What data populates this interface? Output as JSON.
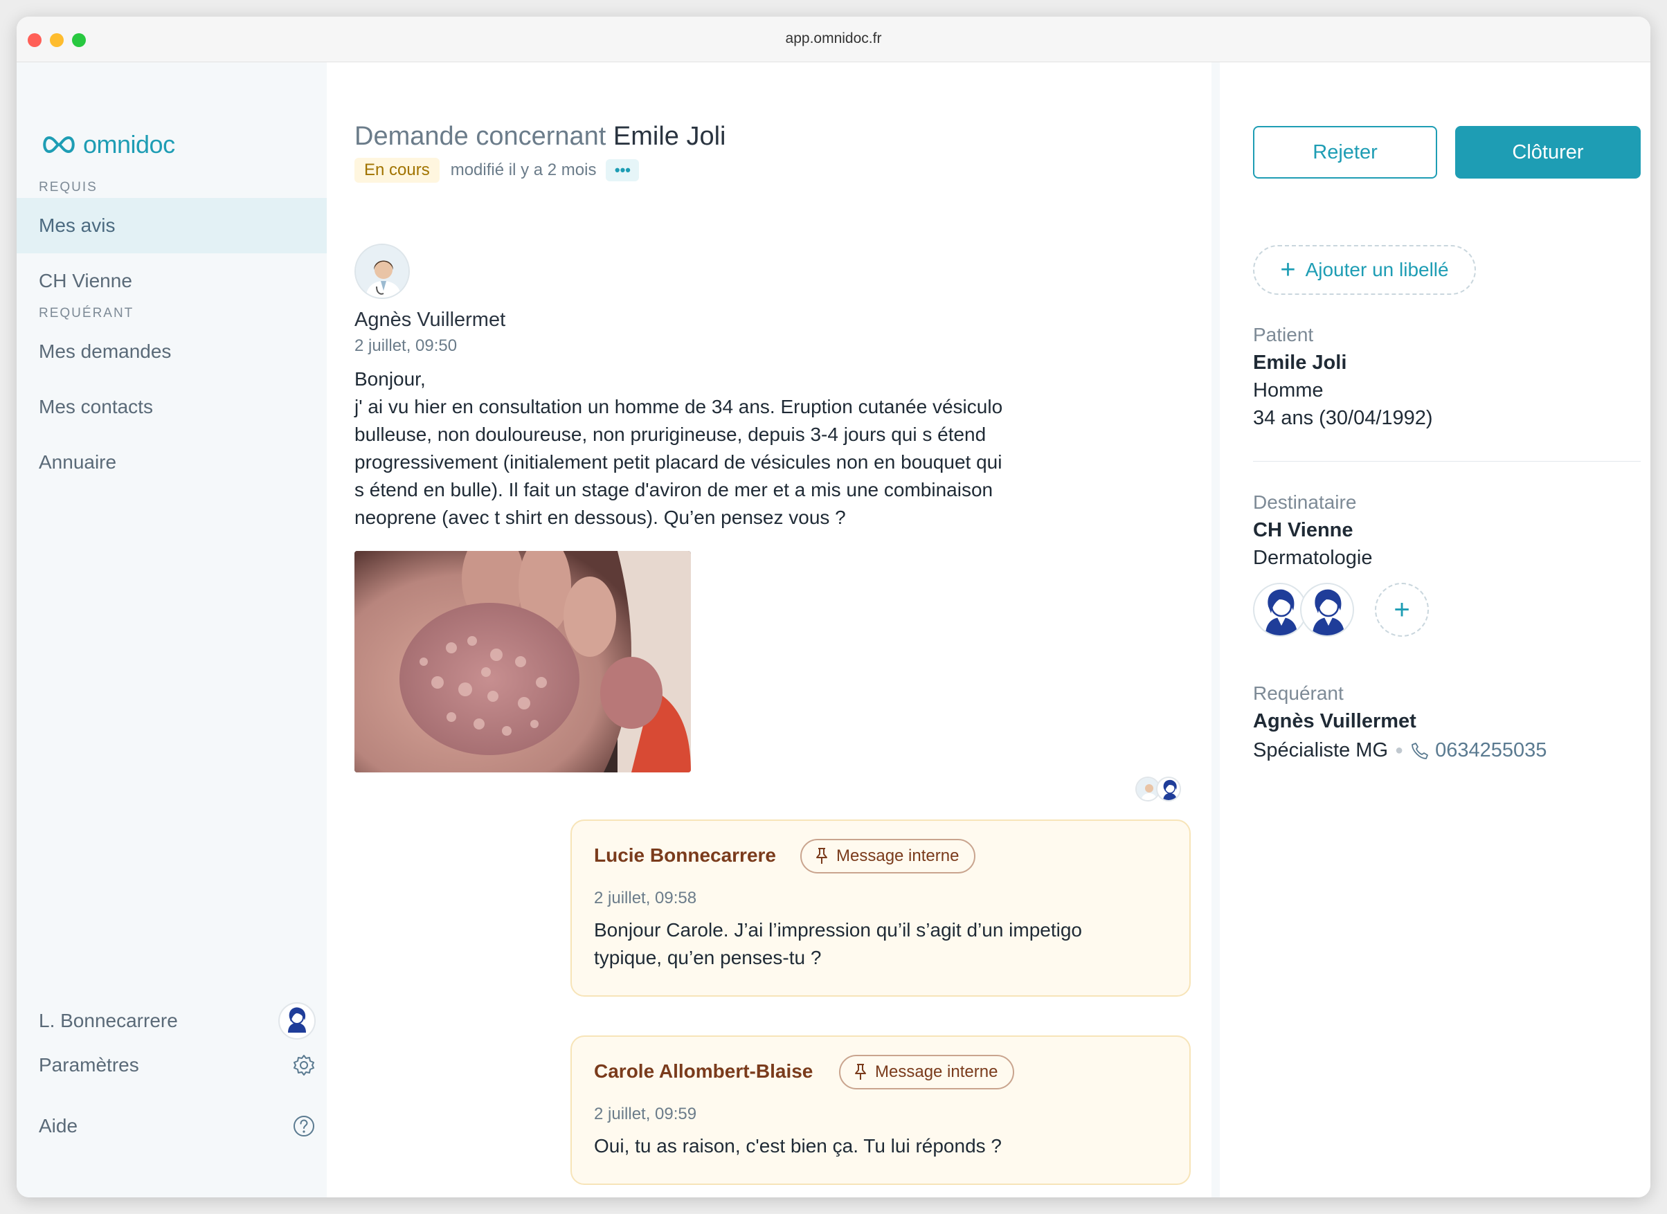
{
  "browser": {
    "url": "app.omnidoc.fr"
  },
  "brand": {
    "name": "omnidoc",
    "color": "#1e9db4"
  },
  "sidebar": {
    "section_requis": "REQUIS",
    "requis_items": [
      {
        "label": "Mes avis",
        "active": true
      },
      {
        "label": "CH Vienne",
        "active": false
      }
    ],
    "section_requerant": "REQUÉRANT",
    "requerant_items": [
      {
        "label": "Mes demandes"
      },
      {
        "label": "Mes contacts"
      },
      {
        "label": "Annuaire"
      }
    ],
    "user_name": "L. Bonnecarrere",
    "settings_label": "Paramètres",
    "help_label": "Aide"
  },
  "request": {
    "title_prefix": "Demande concernant",
    "patient_name": "Emile Joli",
    "status": "En cours",
    "modified": "modifié il y a 2 mois",
    "more_label": "•••"
  },
  "first_message": {
    "author": "Agnès Vuillermet",
    "date": "2 juillet, 09:50",
    "greeting": "Bonjour,",
    "lines": [
      "j' ai vu hier en consultation un homme de 34 ans. Eruption cutanée vésiculo",
      "bulleuse, non douloureuse, non prurigineuse, depuis 3-4 jours qui s étend",
      "progressivement (initialement petit placard de vésicules non en bouquet qui",
      "s étend en bulle). Il fait un stage d'aviron de mer et a mis  une combinaison",
      "neoprene (avec t shirt en dessous). Qu’en pensez vous ?"
    ]
  },
  "internal_messages": [
    {
      "author": "Lucie Bonnecarrere",
      "tag": "Message interne",
      "date": "2 juillet, 09:58",
      "lines": [
        "Bonjour Carole. J’ai l’impression qu’il s’agit d’un impetigo",
        "typique, qu’en penses-tu ?"
      ]
    },
    {
      "author": "Carole Allombert-Blaise",
      "tag": "Message interne",
      "date": "2 juillet, 09:59",
      "lines": [
        "Oui, tu as raison, c'est bien ça. Tu lui réponds ?"
      ]
    }
  ],
  "actions": {
    "reject": "Rejeter",
    "close": "Clôturer",
    "add_label": "Ajouter un libellé"
  },
  "patient": {
    "label": "Patient",
    "name": "Emile Joli",
    "sex": "Homme",
    "age": "34 ans (30/04/1992)"
  },
  "recipient": {
    "label": "Destinataire",
    "name": "CH Vienne",
    "department": "Dermatologie"
  },
  "requester": {
    "label": "Requérant",
    "name": "Agnès Vuillermet",
    "role": "Spécialiste MG",
    "phone": "0634255035"
  }
}
